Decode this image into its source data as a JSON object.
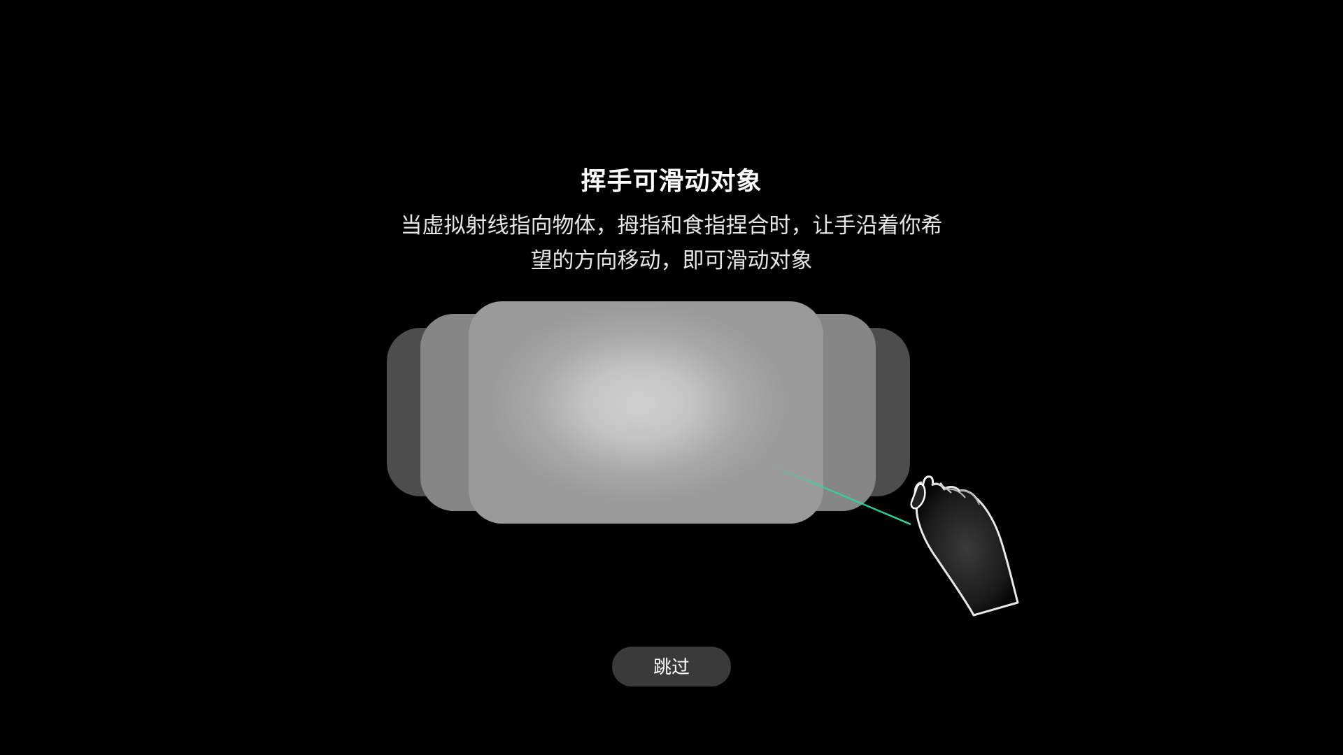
{
  "tutorial": {
    "title": "挥手可滑动对象",
    "description_line1": "当虚拟射线指向物体，拇指和食指捏合时，让手沿着你希",
    "description_line2": "望的方向移动，即可滑动对象"
  },
  "skip_button": {
    "label": "跳过"
  },
  "illustration": {
    "ray_color": "#2fd9a0",
    "hand_icon": "pinch-hand-icon"
  }
}
